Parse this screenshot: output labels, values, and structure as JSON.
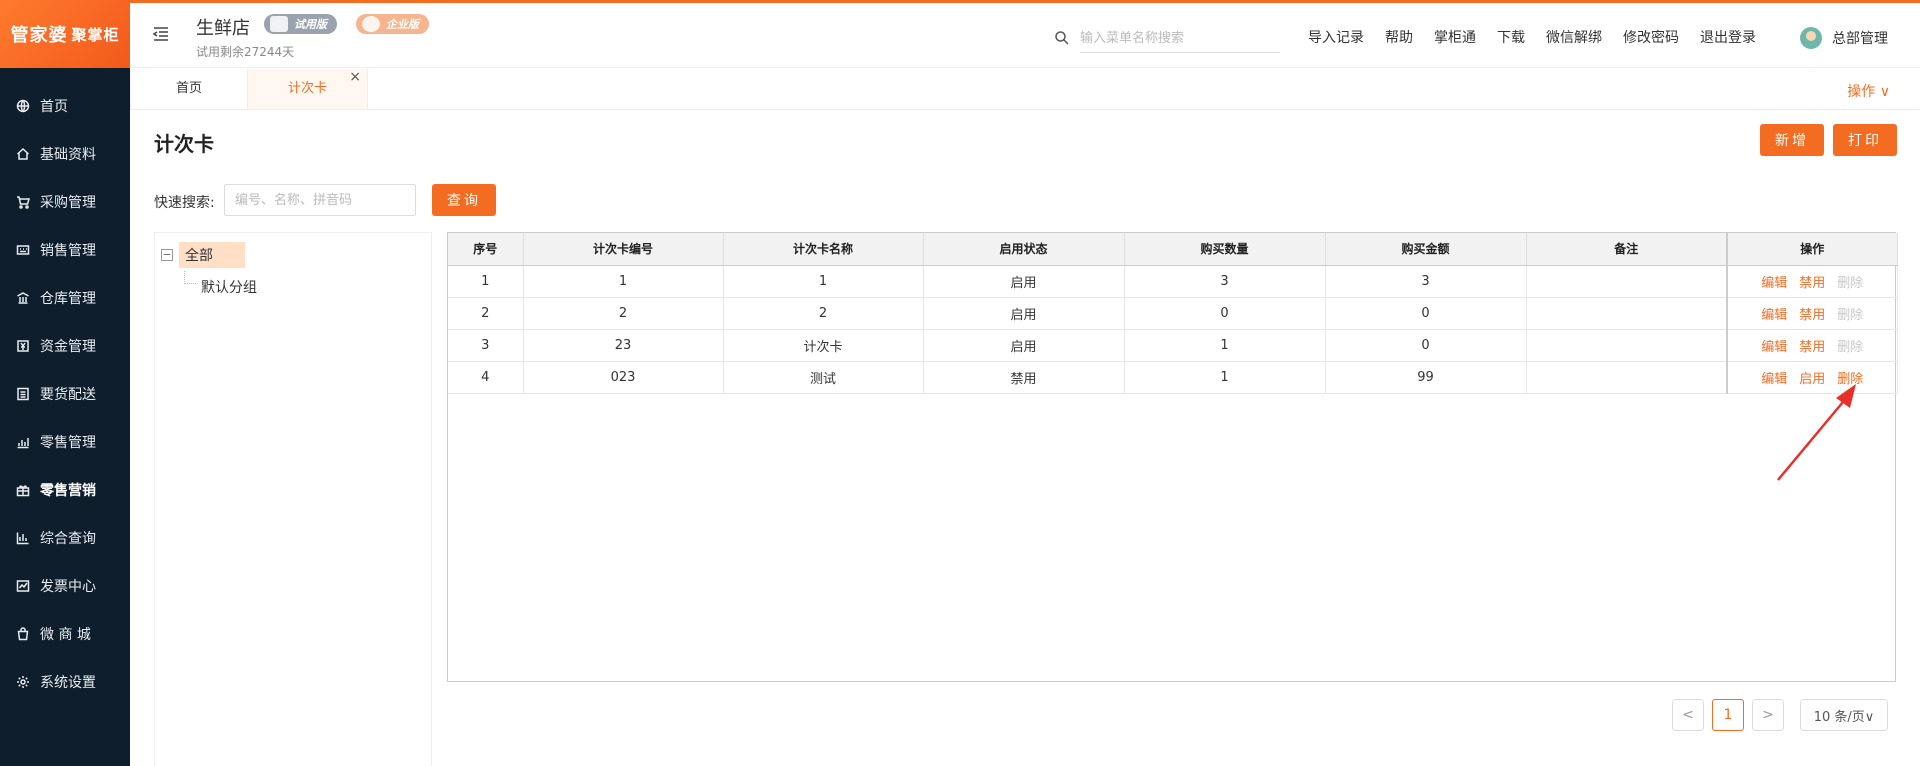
{
  "brand": {
    "logo_text": "管家婆",
    "logo_sub": "聚掌柜",
    "accent": "#f36c21",
    "sidebar_bg": "#0f1e2d"
  },
  "sidebar": {
    "items": [
      {
        "label": "首页",
        "icon": "globe-icon"
      },
      {
        "label": "基础资料",
        "icon": "home-icon"
      },
      {
        "label": "采购管理",
        "icon": "cart-icon"
      },
      {
        "label": "销售管理",
        "icon": "keyboard-icon"
      },
      {
        "label": "仓库管理",
        "icon": "bank-icon"
      },
      {
        "label": "资金管理",
        "icon": "money-icon"
      },
      {
        "label": "要货配送",
        "icon": "list-icon"
      },
      {
        "label": "零售管理",
        "icon": "chart-icon"
      },
      {
        "label": "零售营销",
        "icon": "gift-icon"
      },
      {
        "label": "综合查询",
        "icon": "bar-chart-icon"
      },
      {
        "label": "发票中心",
        "icon": "invoice-icon"
      },
      {
        "label": "微 商 城",
        "icon": "bag-icon"
      },
      {
        "label": "系统设置",
        "icon": "gear-icon"
      }
    ]
  },
  "header": {
    "store_name": "生鲜店",
    "badge_trial": "试用版",
    "badge_enterprise": "企业版",
    "trial_left": "试用剩余27244天",
    "search_placeholder": "输入菜单名称搜索",
    "links": [
      "导入记录",
      "帮助",
      "掌柜通",
      "下载",
      "微信解绑",
      "修改密码",
      "退出登录"
    ],
    "user_name": "总部管理"
  },
  "tabs": {
    "home": "首页",
    "active": "计次卡",
    "close": "×",
    "ops": "操作 ∨"
  },
  "page": {
    "title": "计次卡",
    "add_label": "新增",
    "print_label": "打印",
    "quick_search_label": "快速搜索:",
    "quick_search_placeholder": "编号、名称、拼音码",
    "query_label": "查询"
  },
  "tree": {
    "root": "全部",
    "toggle": "−",
    "child": "默认分组"
  },
  "table": {
    "columns": [
      "序号",
      "计次卡编号",
      "计次卡名称",
      "启用状态",
      "购买数量",
      "购买金额",
      "备注",
      "操作"
    ],
    "rows": [
      {
        "seq": "1",
        "code": "1",
        "name": "1",
        "status": "启用",
        "qty": "3",
        "amount": "3",
        "remark": "",
        "edit": "编辑",
        "toggle": "禁用",
        "del": "删除",
        "del_enabled": false
      },
      {
        "seq": "2",
        "code": "2",
        "name": "2",
        "status": "启用",
        "qty": "0",
        "amount": "0",
        "remark": "",
        "edit": "编辑",
        "toggle": "禁用",
        "del": "删除",
        "del_enabled": false
      },
      {
        "seq": "3",
        "code": "23",
        "name": "计次卡",
        "status": "启用",
        "qty": "1",
        "amount": "0",
        "remark": "",
        "edit": "编辑",
        "toggle": "禁用",
        "del": "删除",
        "del_enabled": false
      },
      {
        "seq": "4",
        "code": "023",
        "name": "测试",
        "status": "禁用",
        "qty": "1",
        "amount": "99",
        "remark": "",
        "edit": "编辑",
        "toggle": "启用",
        "del": "删除",
        "del_enabled": true
      }
    ]
  },
  "pagination": {
    "prev": "<",
    "current": "1",
    "next": ">",
    "page_size": "10 条/页∨"
  }
}
